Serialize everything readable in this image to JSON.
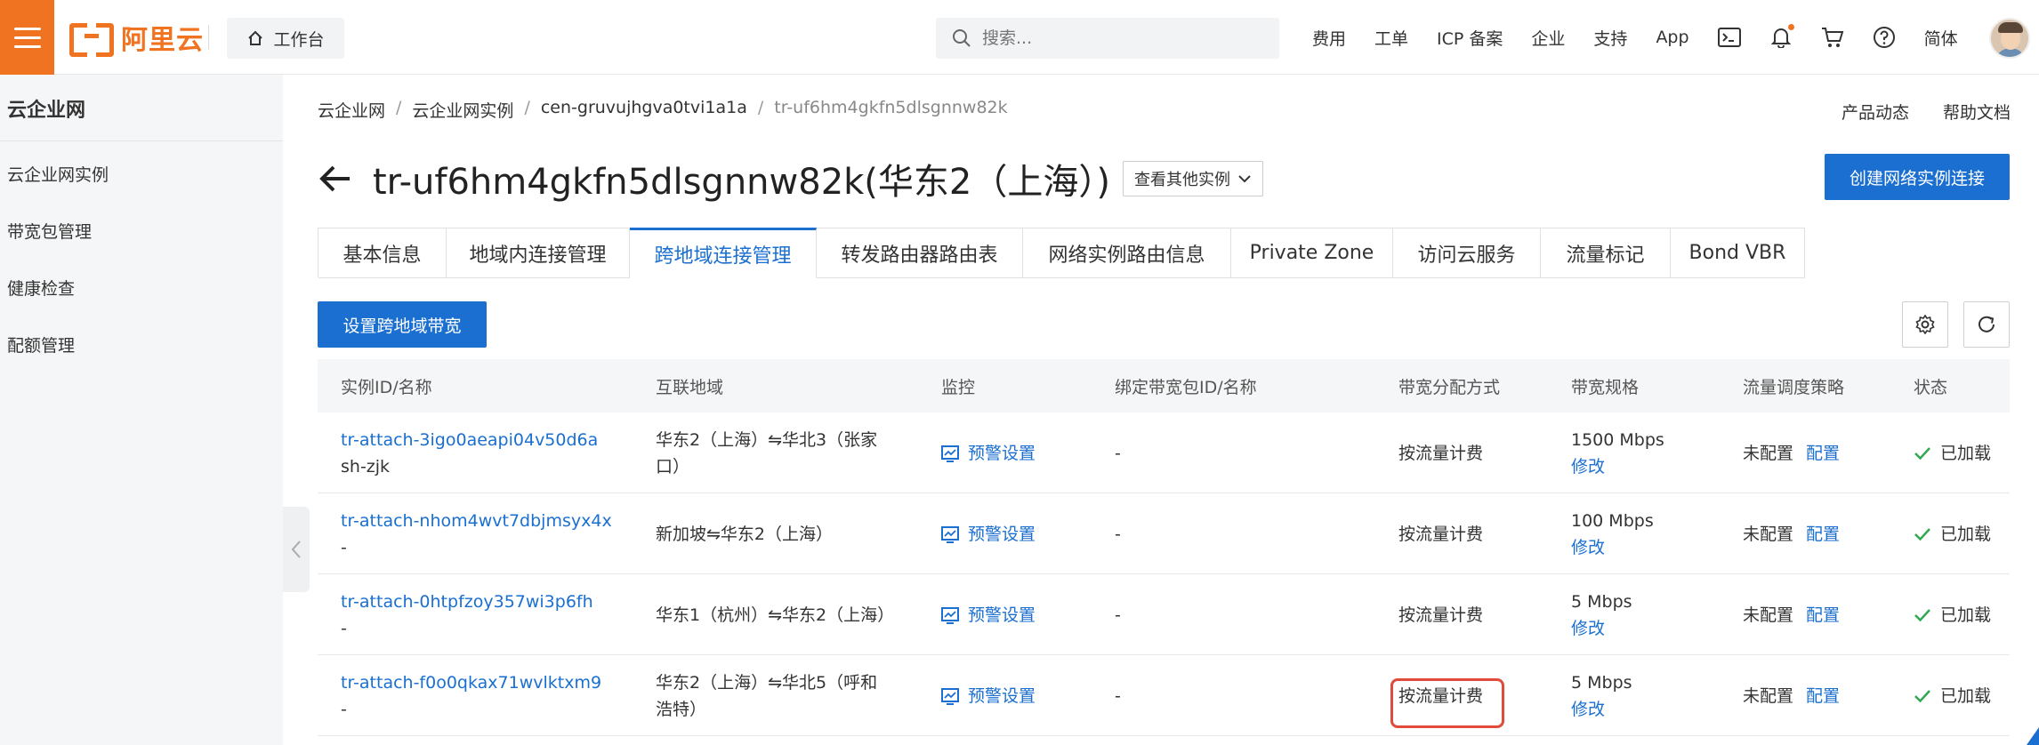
{
  "header": {
    "logo_text": "阿里云",
    "workbench": "工作台",
    "search_placeholder": "搜索...",
    "links": [
      "费用",
      "工单",
      "ICP 备案",
      "企业",
      "支持",
      "App"
    ],
    "lang": "简体"
  },
  "sidebar": {
    "title": "云企业网",
    "items": [
      "云企业网实例",
      "带宽包管理",
      "健康检查",
      "配额管理"
    ]
  },
  "breadcrumb": [
    "云企业网",
    "云企业网实例",
    "cen-gruvujhgva0tvi1a1a",
    "tr-uf6hm4gkfn5dlsgnnw82k"
  ],
  "top_links": [
    "产品动态",
    "帮助文档"
  ],
  "page": {
    "title": "tr-uf6hm4gkfn5dlsgnnw82k(华东2（上海）)",
    "switch_label": "查看其他实例",
    "create_button": "创建网络实例连接",
    "set_bandwidth_button": "设置跨地域带宽"
  },
  "tabs": [
    {
      "label": "基本信息",
      "active": false
    },
    {
      "label": "地域内连接管理",
      "active": false
    },
    {
      "label": "跨地域连接管理",
      "active": true
    },
    {
      "label": "转发路由器路由表",
      "active": false
    },
    {
      "label": "网络实例路由信息",
      "active": false
    },
    {
      "label": "Private Zone",
      "active": false
    },
    {
      "label": "访问云服务",
      "active": false
    },
    {
      "label": "流量标记",
      "active": false
    },
    {
      "label": "Bond VBR",
      "active": false
    }
  ],
  "table": {
    "columns": [
      "实例ID/名称",
      "互联地域",
      "监控",
      "绑定带宽包ID/名称",
      "带宽分配方式",
      "带宽规格",
      "流量调度策略",
      "状态"
    ],
    "rows": [
      {
        "id": "tr-attach-3igo0aeapi04v50d6a",
        "name": "sh-zjk",
        "region_1": "华东2（上海）⇋华北3（张家",
        "region_2": "口）",
        "monitor": "预警设置",
        "package": "-",
        "billing": "按流量计费",
        "spec": "1500 Mbps",
        "modify": "修改",
        "policy": "未配置",
        "configure": "配置",
        "status": "已加载"
      },
      {
        "id": "tr-attach-nhom4wvt7dbjmsyx4x",
        "name": "-",
        "region_1": "新加坡⇋华东2（上海）",
        "region_2": "",
        "monitor": "预警设置",
        "package": "-",
        "billing": "按流量计费",
        "spec": "100 Mbps",
        "modify": "修改",
        "policy": "未配置",
        "configure": "配置",
        "status": "已加载"
      },
      {
        "id": "tr-attach-0htpfzoy357wi3p6fh",
        "name": "-",
        "region_1": "华东1（杭州）⇋华东2（上海）",
        "region_2": "",
        "monitor": "预警设置",
        "package": "-",
        "billing": "按流量计费",
        "spec": "5 Mbps",
        "modify": "修改",
        "policy": "未配置",
        "configure": "配置",
        "status": "已加载"
      },
      {
        "id": "tr-attach-f0o0qkax71wvlktxm9",
        "name": "-",
        "region_1": "华东2（上海）⇋华北5（呼和",
        "region_2": "浩特）",
        "monitor": "预警设置",
        "package": "-",
        "billing": "按流量计费",
        "spec": "5 Mbps",
        "modify": "修改",
        "policy": "未配置",
        "configure": "配置",
        "status": "已加载"
      }
    ]
  },
  "colors": {
    "brand": "#f07321",
    "primary": "#1a6fd1",
    "highlight": "#e04b3c",
    "success": "#2fa84f"
  }
}
